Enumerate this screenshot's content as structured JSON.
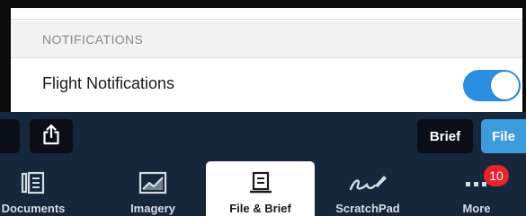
{
  "settings": {
    "section_title": "NOTIFICATIONS",
    "flight_notifications": {
      "label": "Flight Notifications",
      "enabled": true
    }
  },
  "toolbar": {
    "share_icon": "share-icon",
    "brief_label": "Brief",
    "file_label": "File"
  },
  "tabbar": {
    "items": [
      {
        "label": "Documents",
        "icon": "documents-icon",
        "active": false
      },
      {
        "label": "Imagery",
        "icon": "imagery-icon",
        "active": false
      },
      {
        "label": "File & Brief",
        "icon": "file-brief-icon",
        "active": true
      },
      {
        "label": "ScratchPad",
        "icon": "scratchpad-icon",
        "active": false
      },
      {
        "label": "More",
        "icon": "more-icon",
        "active": false,
        "badge": "10"
      }
    ]
  },
  "colors": {
    "toggle_on": "#2a8fe0",
    "toolbar_bg": "#16273b",
    "file_button": "#3d9bdc",
    "badge": "#e8242a"
  }
}
